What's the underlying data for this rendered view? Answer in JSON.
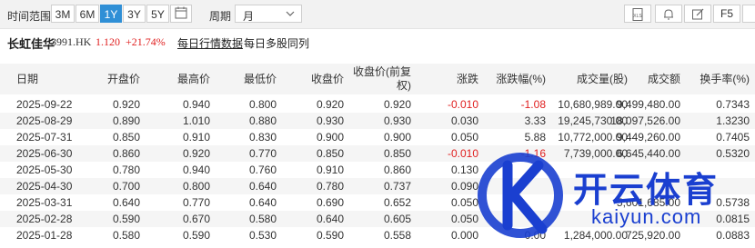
{
  "toolbar": {
    "time_range_label": "时间范围",
    "ranges": [
      "3M",
      "6M",
      "1Y",
      "3Y",
      "5Y"
    ],
    "active_range": "1Y",
    "period_label": "周期",
    "period_value": "月",
    "f5_label": "F5",
    "accent": "#2f8fd6"
  },
  "stock": {
    "name": "长虹佳华",
    "code": "3991.HK",
    "price": "1.120",
    "change_pct": "+21.74%",
    "up_color": "#e02020"
  },
  "links": {
    "daily_data": "每日行情数据",
    "multi_compare": "每日多股同列"
  },
  "table": {
    "headers": {
      "date": "日期",
      "open": "开盘价",
      "high": "最高价",
      "low": "最低价",
      "close": "收盘价",
      "adj_close_1": "收盘价(前复",
      "adj_close_2": "权)",
      "change": "涨跌",
      "change_pct": "涨跌幅(%)",
      "volume": "成交量(股)",
      "amount": "成交额",
      "turnover": "换手率(%)"
    },
    "rows": [
      {
        "date": "2025-09-22",
        "open": "0.920",
        "high": "0.940",
        "low": "0.800",
        "close": "0.920",
        "adj": "0.920",
        "chg": "-0.010",
        "pct": "-1.08",
        "vol": "10,680,989.00",
        "amt": "9,499,480.00",
        "turn": "0.7343",
        "neg": true
      },
      {
        "date": "2025-08-29",
        "open": "0.890",
        "high": "1.010",
        "low": "0.880",
        "close": "0.930",
        "adj": "0.930",
        "chg": "0.030",
        "pct": "3.33",
        "vol": "19,245,730.00",
        "amt": "18,097,526.00",
        "turn": "1.3230",
        "neg": false
      },
      {
        "date": "2025-07-31",
        "open": "0.850",
        "high": "0.910",
        "low": "0.830",
        "close": "0.900",
        "adj": "0.900",
        "chg": "0.050",
        "pct": "5.88",
        "vol": "10,772,000.00",
        "amt": "9,449,260.00",
        "turn": "0.7405",
        "neg": false
      },
      {
        "date": "2025-06-30",
        "open": "0.860",
        "high": "0.920",
        "low": "0.770",
        "close": "0.850",
        "adj": "0.850",
        "chg": "-0.010",
        "pct": "-1.16",
        "vol": "7,739,000.00",
        "amt": "6,645,440.00",
        "turn": "0.5320",
        "neg": true
      },
      {
        "date": "2025-05-30",
        "open": "0.780",
        "high": "0.940",
        "low": "0.760",
        "close": "0.910",
        "adj": "0.860",
        "chg": "0.130",
        "pct": "",
        "vol": "",
        "amt": "",
        "turn": "",
        "neg": false
      },
      {
        "date": "2025-04-30",
        "open": "0.700",
        "high": "0.800",
        "low": "0.640",
        "close": "0.780",
        "adj": "0.737",
        "chg": "0.090",
        "pct": "",
        "vol": "",
        "amt": "",
        "turn": "",
        "neg": false
      },
      {
        "date": "2025-03-31",
        "open": "0.640",
        "high": "0.770",
        "low": "0.640",
        "close": "0.690",
        "adj": "0.652",
        "chg": "0.050",
        "pct": "",
        "vol": "",
        "amt": "5,601,685.00",
        "turn": "0.5738",
        "neg": false
      },
      {
        "date": "2025-02-28",
        "open": "0.590",
        "high": "0.670",
        "low": "0.580",
        "close": "0.640",
        "adj": "0.605",
        "chg": "0.050",
        "pct": "",
        "vol": "",
        "amt": "",
        "turn": "0.0815",
        "neg": false
      },
      {
        "date": "2025-01-28",
        "open": "0.580",
        "high": "0.590",
        "low": "0.530",
        "close": "0.590",
        "adj": "0.558",
        "chg": "0.000",
        "pct": "0.00",
        "vol": "1,284,000.00",
        "amt": "725,920.00",
        "turn": "0.0883",
        "neg": false
      }
    ]
  },
  "watermark": {
    "brand_cn": "开云体育",
    "brand_en": "kaiyun.com",
    "color": "#1a3fd0"
  }
}
